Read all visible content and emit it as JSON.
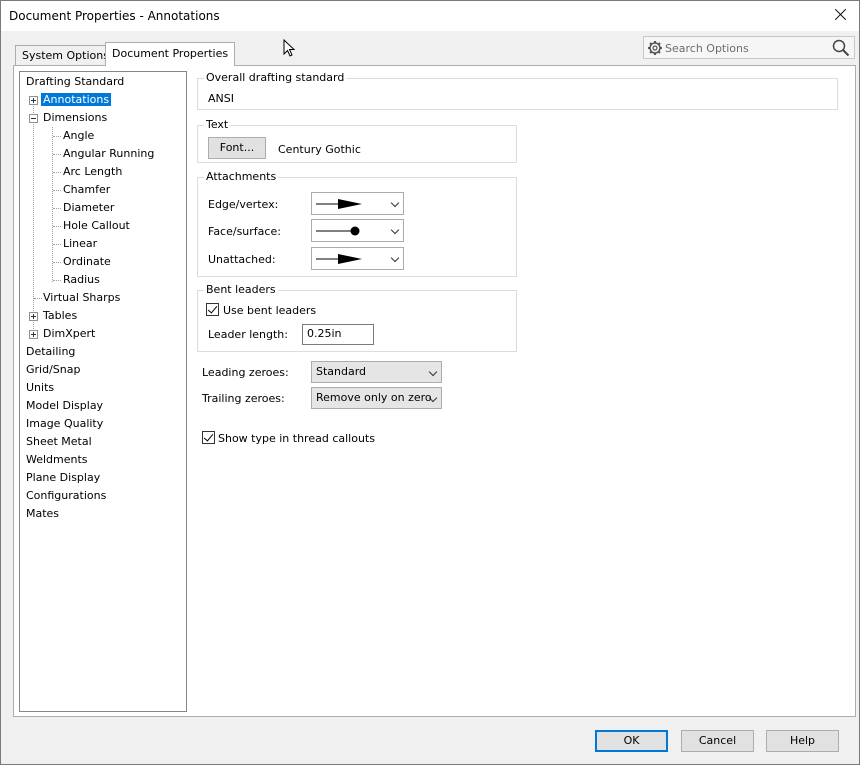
{
  "window": {
    "title": "Document Properties - Annotations"
  },
  "tabs": [
    {
      "label": "System Options",
      "active": false
    },
    {
      "label": "Document Properties",
      "active": true
    }
  ],
  "search": {
    "placeholder": "Search Options"
  },
  "tree": {
    "items": [
      {
        "label": "Drafting Standard"
      },
      {
        "label": "Annotations",
        "selected": true,
        "expander": "plus"
      },
      {
        "label": "Dimensions",
        "expander": "minus"
      },
      {
        "label": "Angle"
      },
      {
        "label": "Angular Running"
      },
      {
        "label": "Arc Length"
      },
      {
        "label": "Chamfer"
      },
      {
        "label": "Diameter"
      },
      {
        "label": "Hole Callout"
      },
      {
        "label": "Linear"
      },
      {
        "label": "Ordinate"
      },
      {
        "label": "Radius"
      },
      {
        "label": "Virtual Sharps"
      },
      {
        "label": "Tables",
        "expander": "plus"
      },
      {
        "label": "DimXpert",
        "expander": "plus"
      },
      {
        "label": "Detailing"
      },
      {
        "label": "Grid/Snap"
      },
      {
        "label": "Units"
      },
      {
        "label": "Model Display"
      },
      {
        "label": "Image Quality"
      },
      {
        "label": "Sheet Metal"
      },
      {
        "label": "Weldments"
      },
      {
        "label": "Plane Display"
      },
      {
        "label": "Configurations"
      },
      {
        "label": "Mates"
      }
    ]
  },
  "drafting": {
    "title": "Overall drafting standard",
    "value": "ANSI"
  },
  "text_group": {
    "title": "Text",
    "font_button": "Font...",
    "font_name": "Century Gothic"
  },
  "attachments": {
    "title": "Attachments",
    "edge_label": "Edge/vertex:",
    "face_label": "Face/surface:",
    "unattached_label": "Unattached:"
  },
  "bent": {
    "title": "Bent leaders",
    "use_label": "Use bent leaders",
    "use_checked": true,
    "length_label": "Leader length:",
    "length_value": "0.25in"
  },
  "zeroes": {
    "leading_label": "Leading zeroes:",
    "leading_value": "Standard",
    "trailing_label": "Trailing zeroes:",
    "trailing_value": "Remove only on zero"
  },
  "thread": {
    "label": "Show type in thread callouts",
    "checked": true
  },
  "buttons": {
    "ok": "OK",
    "cancel": "Cancel",
    "help": "Help"
  }
}
